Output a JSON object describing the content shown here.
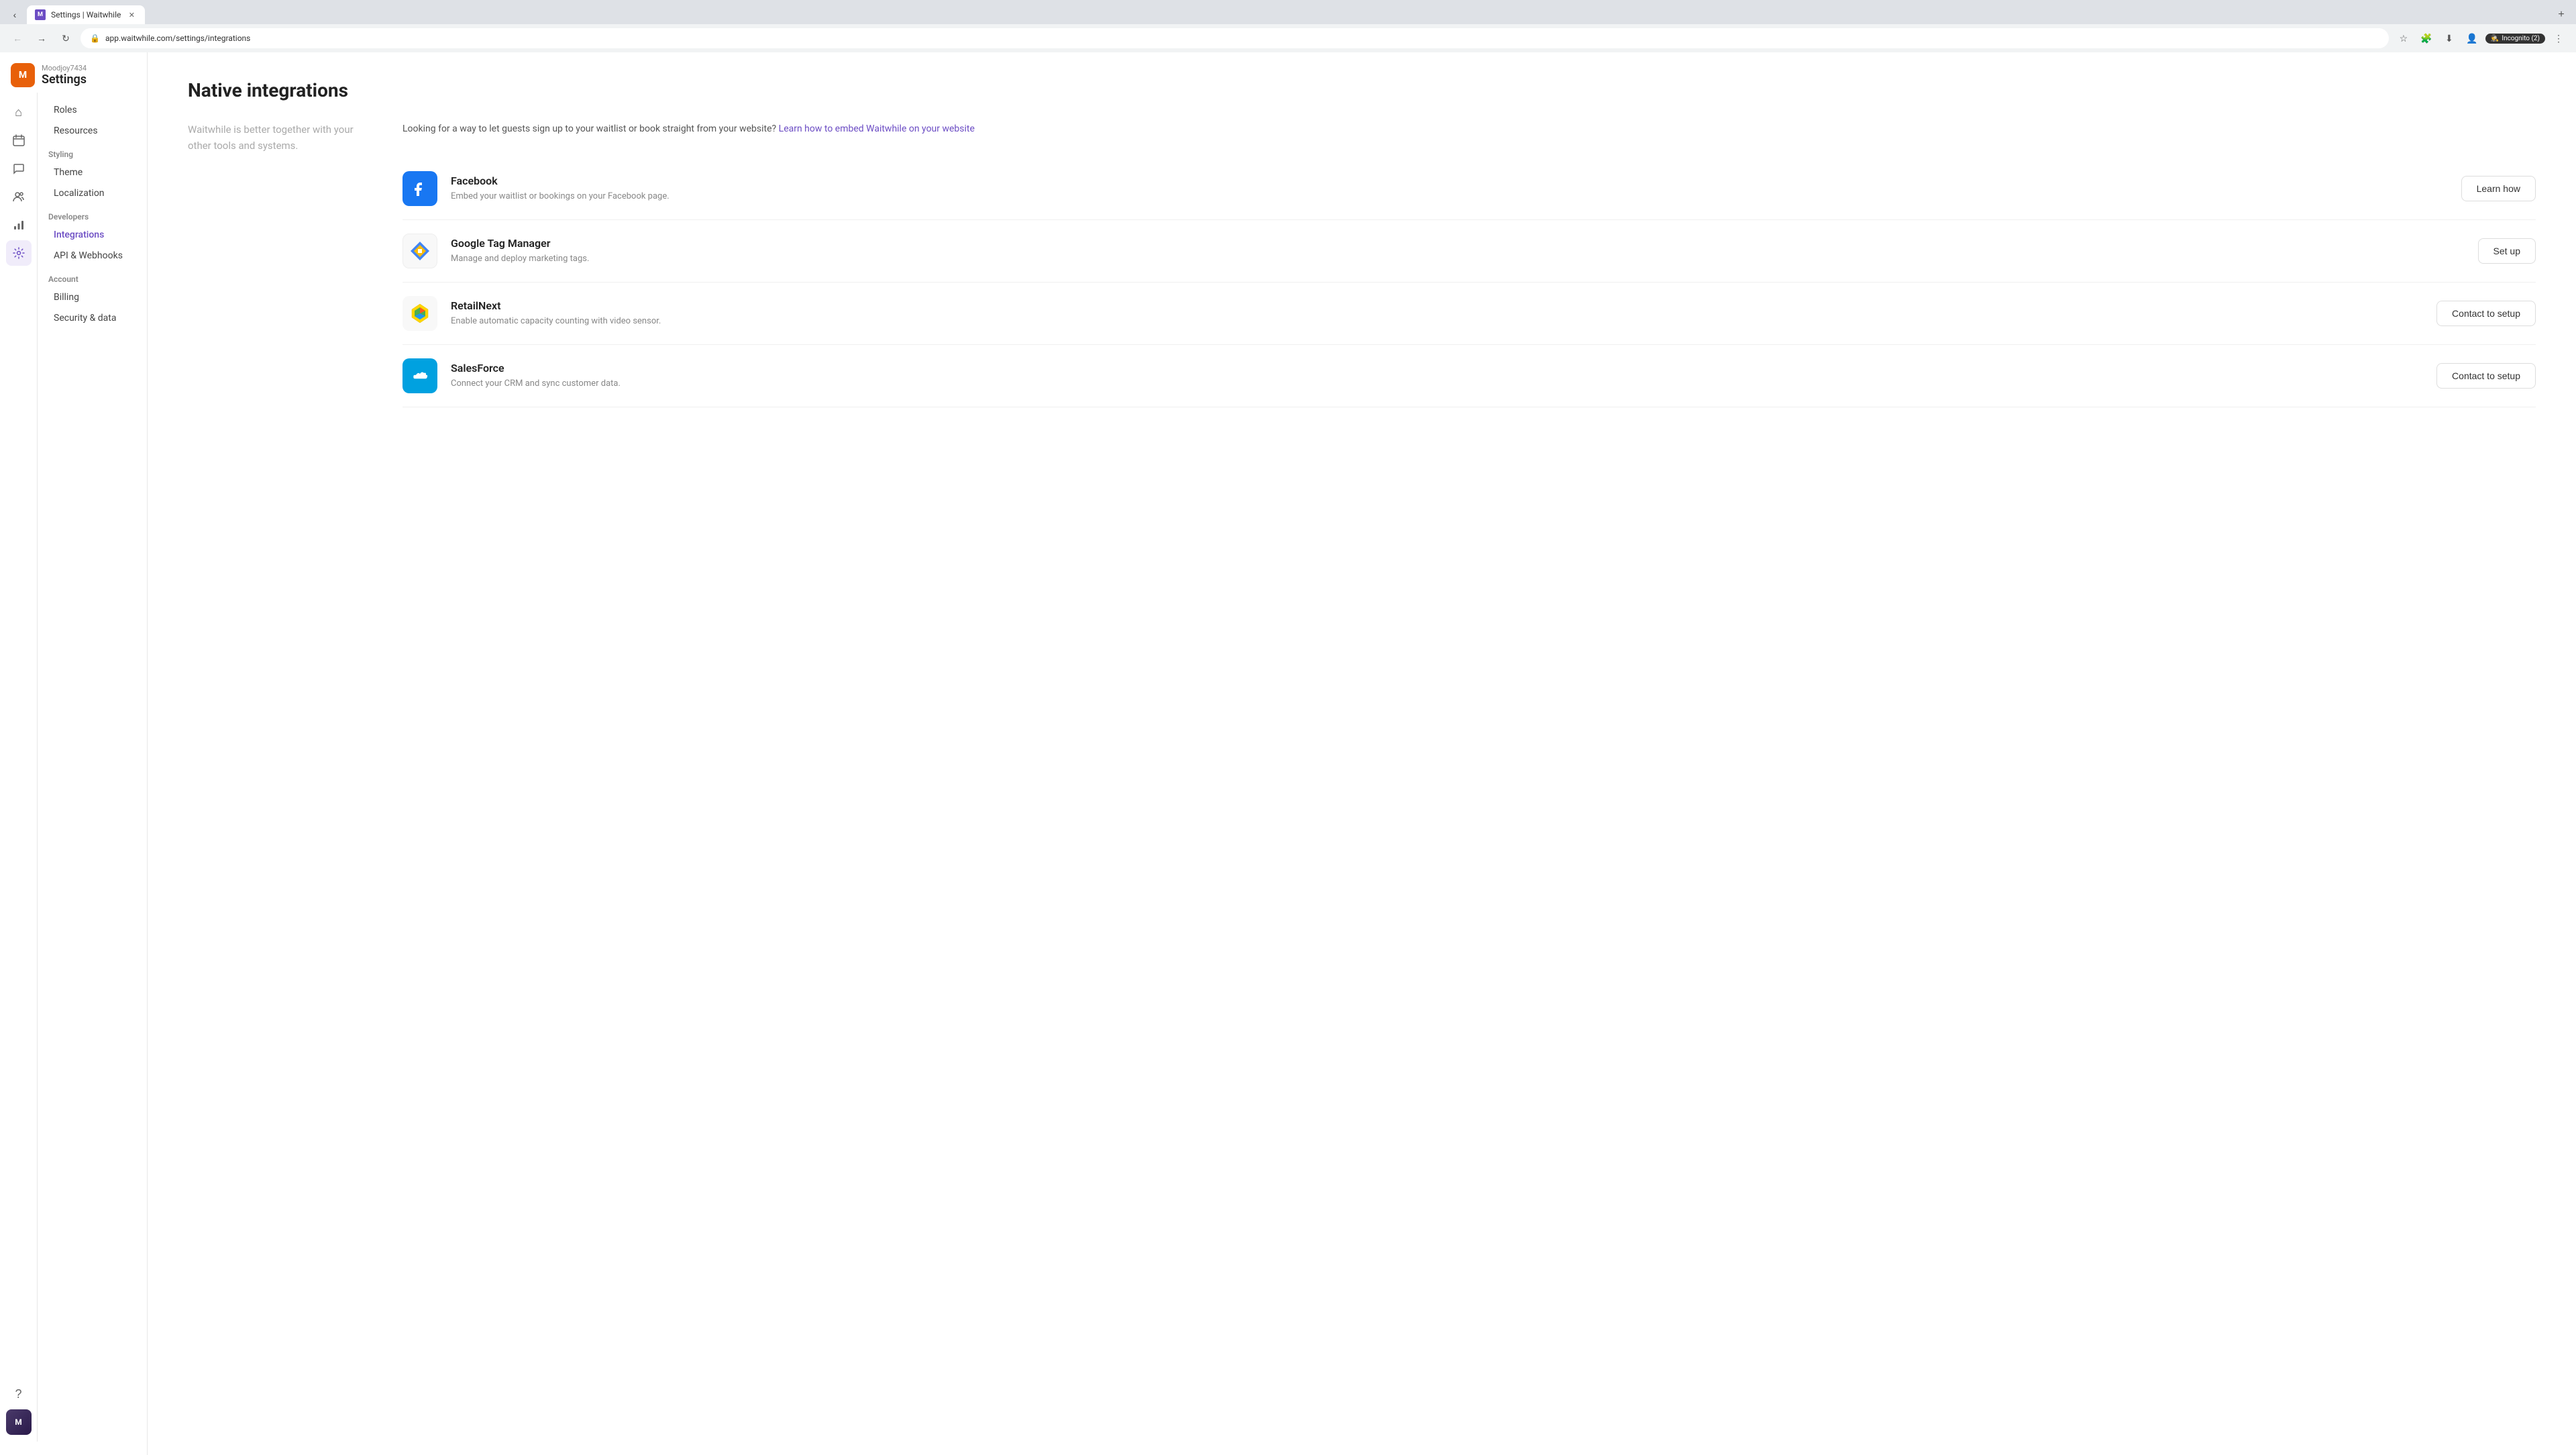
{
  "browser": {
    "tab_title": "Settings | Waitwhile",
    "tab_favicon_label": "M",
    "url": "app.waitwhile.com/settings/integrations",
    "incognito_label": "Incognito (2)",
    "new_tab_label": "+"
  },
  "sidebar": {
    "account_name": "Moodjoy7434",
    "app_title": "Settings",
    "avatar_label": "M",
    "nav_icons": [
      {
        "name": "home-icon",
        "symbol": "⌂",
        "active": false
      },
      {
        "name": "calendar-icon",
        "symbol": "▦",
        "active": false
      },
      {
        "name": "chat-icon",
        "symbol": "💬",
        "active": false
      },
      {
        "name": "users-icon",
        "symbol": "👥",
        "active": false
      },
      {
        "name": "analytics-icon",
        "symbol": "📊",
        "active": false
      },
      {
        "name": "settings-icon",
        "symbol": "⚙",
        "active": true
      },
      {
        "name": "help-icon",
        "symbol": "?",
        "active": false
      },
      {
        "name": "avatar-icon",
        "symbol": "M",
        "active": false
      }
    ],
    "menu_items": [
      {
        "label": "Roles",
        "active": false,
        "section": ""
      },
      {
        "label": "Resources",
        "active": false,
        "section": ""
      },
      {
        "label": "Styling",
        "active": false,
        "section": "Styling"
      },
      {
        "label": "Theme",
        "active": false,
        "section": ""
      },
      {
        "label": "Localization",
        "active": false,
        "section": ""
      },
      {
        "label": "Developers",
        "active": false,
        "section": "Developers"
      },
      {
        "label": "Integrations",
        "active": true,
        "section": ""
      },
      {
        "label": "API & Webhooks",
        "active": false,
        "section": ""
      },
      {
        "label": "Account",
        "active": false,
        "section": "Account"
      },
      {
        "label": "Billing",
        "active": false,
        "section": ""
      },
      {
        "label": "Security & data",
        "active": false,
        "section": ""
      }
    ]
  },
  "page": {
    "title": "Native integrations",
    "description": "Waitwhile is better together with your other tools and systems.",
    "embed_notice_prefix": "Looking for a way to let guests sign up to your waitlist or book straight from your website?",
    "embed_link_text": "Learn how to embed Waitwhile on your website",
    "integrations": [
      {
        "name": "Facebook",
        "description": "Embed your waitlist or bookings on your Facebook page.",
        "button_label": "Learn how",
        "logo_type": "facebook"
      },
      {
        "name": "Google Tag Manager",
        "description": "Manage and deploy marketing tags.",
        "button_label": "Set up",
        "logo_type": "gtm"
      },
      {
        "name": "RetailNext",
        "description": "Enable automatic capacity counting with video sensor.",
        "button_label": "Contact to setup",
        "logo_type": "retailnext"
      },
      {
        "name": "SalesForce",
        "description": "Connect your CRM and sync customer data.",
        "button_label": "Contact to setup",
        "logo_type": "salesforce"
      }
    ]
  }
}
